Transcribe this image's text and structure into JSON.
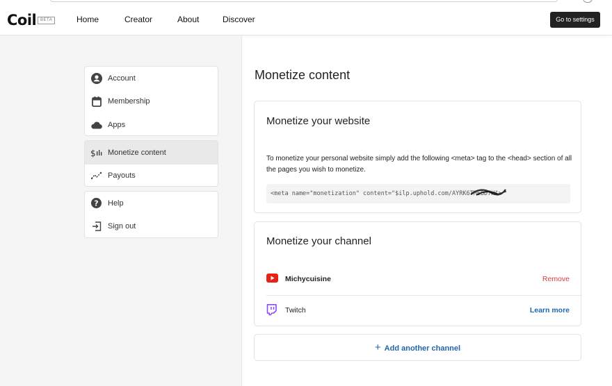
{
  "app": {
    "logo": "Coil",
    "badge": "BETA"
  },
  "nav": {
    "home": "Home",
    "creator": "Creator",
    "about": "About",
    "discover": "Discover",
    "settings_button": "Go to settings"
  },
  "sidebar": {
    "groups": [
      {
        "items": [
          {
            "label": "Account",
            "icon": "account-icon"
          },
          {
            "label": "Membership",
            "icon": "calendar-icon"
          },
          {
            "label": "Apps",
            "icon": "cloud-icon"
          }
        ]
      },
      {
        "items": [
          {
            "label": "Monetize content",
            "icon": "dollar-icon",
            "active": true
          },
          {
            "label": "Payouts",
            "icon": "chart-icon"
          }
        ]
      },
      {
        "items": [
          {
            "label": "Help",
            "icon": "help-icon"
          },
          {
            "label": "Sign out",
            "icon": "sign-out-icon"
          }
        ]
      }
    ]
  },
  "main": {
    "title": "Monetize content",
    "website": {
      "title": "Monetize your website",
      "description": "To monetize your personal website simply add the following <meta> tag to the <head> section of all the pages you wish to monetize.",
      "code": "<meta name=\"monetization\" content=\"$ilp.uphold.com/AYRK6TMEBD7H\">"
    },
    "channel": {
      "title": "Monetize your channel",
      "rows": [
        {
          "name": "Michycuisine",
          "icon": "youtube-icon",
          "action": "Remove",
          "action_color": "#d0423b"
        },
        {
          "name": "Twitch",
          "icon": "twitch-icon",
          "action": "Learn more",
          "action_color": "#1f66b0"
        }
      ]
    },
    "add_channel": "Add another channel"
  },
  "colors": {
    "accent_blue": "#1f66b0",
    "remove_red": "#d0423b",
    "youtube_red": "#e62117",
    "twitch_purple": "#9146ff"
  }
}
